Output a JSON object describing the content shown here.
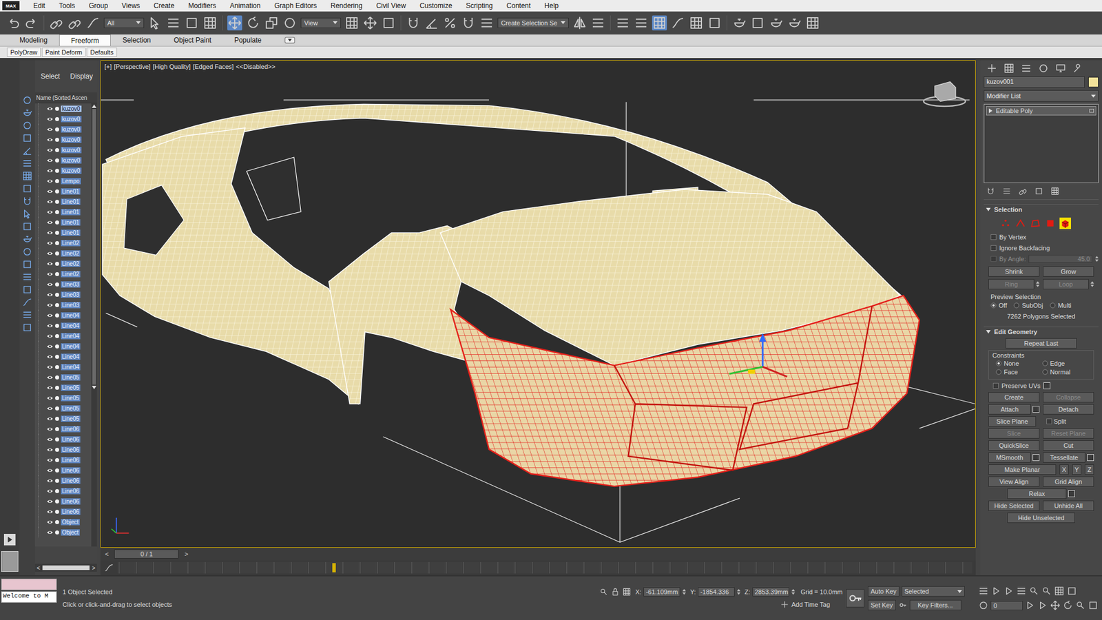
{
  "app": {
    "logo": "MAX"
  },
  "menu": [
    "Edit",
    "Tools",
    "Group",
    "Views",
    "Create",
    "Modifiers",
    "Animation",
    "Graph Editors",
    "Rendering",
    "Civil View",
    "Customize",
    "Scripting",
    "Content",
    "Help"
  ],
  "toolbar": {
    "selection_filter": "All",
    "reference_coord": "View",
    "named_selection": "Create Selection Se"
  },
  "ribbon": {
    "tabs": [
      {
        "label": "Modeling",
        "selected": false
      },
      {
        "label": "Freeform",
        "selected": true
      },
      {
        "label": "Selection",
        "selected": false
      },
      {
        "label": "Object Paint",
        "selected": false
      },
      {
        "label": "Populate",
        "selected": false
      }
    ],
    "subtabs": [
      {
        "label": "PolyDraw",
        "selected": false
      },
      {
        "label": "Paint Deform",
        "selected": false
      },
      {
        "label": "Defaults",
        "selected": false
      }
    ]
  },
  "explorer": {
    "tabs": [
      {
        "label": "Select",
        "selected": false
      },
      {
        "label": "Display",
        "selected": false
      }
    ],
    "column": "Name (Sorted Ascen",
    "items": [
      {
        "name": "kuzov0",
        "visible": true,
        "selected": true
      },
      {
        "name": "kuzov0",
        "visible": true,
        "selected": false
      },
      {
        "name": "kuzov0",
        "visible": true,
        "selected": false
      },
      {
        "name": "kuzov0",
        "visible": true,
        "selected": false
      },
      {
        "name": "kuzov0",
        "visible": true,
        "selected": false
      },
      {
        "name": "kuzov0",
        "visible": true,
        "selected": false
      },
      {
        "name": "kuzov0",
        "visible": true,
        "selected": false
      },
      {
        "name": "Lempo",
        "visible": true,
        "selected": false
      },
      {
        "name": "Line01",
        "visible": true,
        "selected": false
      },
      {
        "name": "Line01",
        "visible": true,
        "selected": false
      },
      {
        "name": "Line01",
        "visible": true,
        "selected": false
      },
      {
        "name": "Line01",
        "visible": true,
        "selected": false
      },
      {
        "name": "Line01",
        "visible": true,
        "selected": false
      },
      {
        "name": "Line02",
        "visible": true,
        "selected": false
      },
      {
        "name": "Line02",
        "visible": true,
        "selected": false
      },
      {
        "name": "Line02",
        "visible": true,
        "selected": false
      },
      {
        "name": "Line02",
        "visible": true,
        "selected": false
      },
      {
        "name": "Line03",
        "visible": true,
        "selected": false
      },
      {
        "name": "Line03",
        "visible": true,
        "selected": false
      },
      {
        "name": "Line03",
        "visible": true,
        "selected": false
      },
      {
        "name": "Line04",
        "visible": true,
        "selected": false
      },
      {
        "name": "Line04",
        "visible": true,
        "selected": false
      },
      {
        "name": "Line04",
        "visible": true,
        "selected": false
      },
      {
        "name": "Line04",
        "visible": true,
        "selected": false
      },
      {
        "name": "Line04",
        "visible": true,
        "selected": false
      },
      {
        "name": "Line04",
        "visible": true,
        "selected": false
      },
      {
        "name": "Line05",
        "visible": true,
        "selected": false
      },
      {
        "name": "Line05",
        "visible": true,
        "selected": false
      },
      {
        "name": "Line05",
        "visible": true,
        "selected": false
      },
      {
        "name": "Line05",
        "visible": true,
        "selected": false
      },
      {
        "name": "Line05",
        "visible": true,
        "selected": false
      },
      {
        "name": "Line06",
        "visible": true,
        "selected": false
      },
      {
        "name": "Line06",
        "visible": true,
        "selected": false
      },
      {
        "name": "Line06",
        "visible": true,
        "selected": false
      },
      {
        "name": "Line06",
        "visible": true,
        "selected": false
      },
      {
        "name": "Line06",
        "visible": true,
        "selected": false
      },
      {
        "name": "Line06",
        "visible": true,
        "selected": false
      },
      {
        "name": "Line06",
        "visible": true,
        "selected": false
      },
      {
        "name": "Line06",
        "visible": true,
        "selected": false
      },
      {
        "name": "Line06",
        "visible": true,
        "selected": false
      },
      {
        "name": "Object",
        "visible": true,
        "selected": false
      },
      {
        "name": "Object",
        "visible": true,
        "selected": false
      }
    ],
    "scroll": {
      "left": "<",
      "right": ">"
    }
  },
  "viewport": {
    "labels": [
      "[+]",
      "[Perspective]",
      "[High Quality]",
      "[Edged Faces]",
      "<<Disabled>>"
    ]
  },
  "timeline": {
    "frame": "0 / 1",
    "prev": "<",
    "next": ">"
  },
  "command_panel": {
    "object_name": "kuzov001",
    "object_color": "#f3e29a",
    "modifier_list": "Modifier List",
    "stack": [
      {
        "label": "Editable Poly",
        "selected": true
      }
    ],
    "selection": {
      "title": "Selection",
      "levels": [
        {
          "kind": "vertex",
          "selected": false
        },
        {
          "kind": "edge",
          "selected": false
        },
        {
          "kind": "border",
          "selected": false
        },
        {
          "kind": "polygon",
          "selected": false
        },
        {
          "kind": "element",
          "selected": true
        }
      ],
      "options": [
        {
          "label": "By Vertex",
          "checked": false,
          "disabled": false
        },
        {
          "label": "Ignore Backfacing",
          "checked": false,
          "disabled": false
        }
      ],
      "by_angle": {
        "label": "By Angle:",
        "value": "45.0",
        "checked": false,
        "disabled": true
      },
      "buttons": [
        {
          "label": "Shrink",
          "disabled": false,
          "spinner": false
        },
        {
          "label": "Grow",
          "disabled": false,
          "spinner": false
        },
        {
          "label": "Ring",
          "disabled": true,
          "spinner": true
        },
        {
          "label": "Loop",
          "disabled": true,
          "spinner": true
        }
      ],
      "preview": {
        "label": "Preview Selection",
        "options": [
          {
            "label": "Off",
            "selected": true
          },
          {
            "label": "SubObj",
            "selected": false
          },
          {
            "label": "Multi",
            "selected": false
          }
        ]
      },
      "count": "7262 Polygons Selected"
    },
    "edit_geometry": {
      "title": "Edit Geometry",
      "repeat": "Repeat Last",
      "constraints": {
        "label": "Constraints",
        "options": [
          {
            "label": "None",
            "selected": true
          },
          {
            "label": "Edge",
            "selected": false
          },
          {
            "label": "Face",
            "selected": false
          },
          {
            "label": "Normal",
            "selected": false
          }
        ]
      },
      "preserve_uvs": {
        "label": "Preserve UVs",
        "checked": false
      },
      "rows": [
        [
          {
            "kind": "button",
            "label": "Create",
            "disabled": false,
            "settings": false
          },
          {
            "kind": "button",
            "label": "Collapse",
            "disabled": true,
            "settings": false
          }
        ],
        [
          {
            "kind": "button",
            "label": "Attach",
            "disabled": false,
            "settings": true
          },
          {
            "kind": "button",
            "label": "Detach",
            "disabled": false,
            "settings": false
          }
        ],
        [
          {
            "kind": "button",
            "label": "Slice Plane",
            "disabled": false,
            "settings": false
          },
          {
            "kind": "checkbox",
            "label": "Split",
            "checked": false
          }
        ],
        [
          {
            "kind": "button",
            "label": "Slice",
            "disabled": true,
            "settings": false
          },
          {
            "kind": "button",
            "label": "Reset Plane",
            "disabled": true,
            "settings": false
          }
        ],
        [
          {
            "kind": "button",
            "label": "QuickSlice",
            "disabled": false,
            "settings": false
          },
          {
            "kind": "button",
            "label": "Cut",
            "disabled": false,
            "settings": false
          }
        ],
        [
          {
            "kind": "button",
            "label": "MSmooth",
            "disabled": false,
            "settings": true
          },
          {
            "kind": "button",
            "label": "Tessellate",
            "disabled": false,
            "settings": true
          }
        ],
        [
          {
            "kind": "button",
            "label": "Make Planar",
            "disabled": false,
            "settings": false
          },
          {
            "kind": "axis",
            "label": "X"
          },
          {
            "kind": "axis",
            "label": "Y"
          },
          {
            "kind": "axis",
            "label": "Z"
          }
        ],
        [
          {
            "kind": "button",
            "label": "View Align",
            "disabled": false,
            "settings": false
          },
          {
            "kind": "button",
            "label": "Grid Align",
            "disabled": false,
            "settings": false
          }
        ],
        [
          {
            "kind": "button",
            "label": "Relax",
            "disabled": false,
            "settings": true
          }
        ],
        [
          {
            "kind": "button",
            "label": "Hide Selected",
            "disabled": false,
            "settings": false
          },
          {
            "kind": "button",
            "label": "Unhide All",
            "disabled": false,
            "settings": false
          }
        ],
        [
          {
            "kind": "button",
            "label": "Hide Unselected",
            "disabled": false,
            "settings": false
          }
        ]
      ]
    }
  },
  "status": {
    "listener": "Welcome to M",
    "selection": "1 Object Selected",
    "prompt": "Click or click-and-drag to select objects",
    "coords": [
      {
        "label": "X:",
        "value": "-61.109mm"
      },
      {
        "label": "Y:",
        "value": "-1854.336"
      },
      {
        "label": "Z:",
        "value": "2853.39mm"
      }
    ],
    "grid": "Grid = 10.0mm",
    "time_tag": "Add Time Tag",
    "auto_key": "Auto Key",
    "key_mode": "Selected",
    "set_key": "Set Key",
    "key_filters": "Key Filters...",
    "frame": "0"
  }
}
